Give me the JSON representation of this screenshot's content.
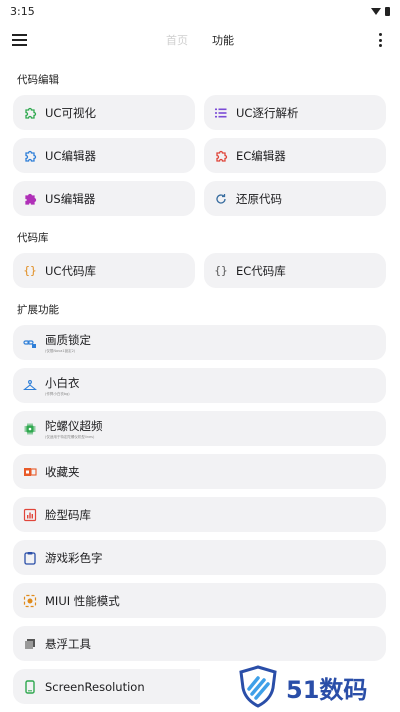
{
  "status_bar": {
    "time": "3:15"
  },
  "header": {
    "tabs": [
      "首页",
      "功能"
    ]
  },
  "sections": {
    "code_edit": {
      "title": "代码编辑",
      "items": [
        "UC可视化",
        "UC逐行解析",
        "UC编辑器",
        "EC编辑器",
        "US编辑器",
        "还原代码"
      ]
    },
    "code_lib": {
      "title": "代码库",
      "items": [
        "UC代码库",
        "EC代码库"
      ]
    },
    "extensions": {
      "title": "扩展功能",
      "items": [
        {
          "label": "画质锁定",
          "sub": "(仅限Nova1锁定2)"
        },
        {
          "label": "小白衣",
          "sub": "(作弊小白衣bg)"
        },
        {
          "label": "陀螺仪超频",
          "sub": "(仅适用于特定陀螺仪机型lines)"
        },
        {
          "label": "收藏夹"
        },
        {
          "label": "脸型码库"
        },
        {
          "label": "游戏彩色字"
        },
        {
          "label": "MIUI 性能模式"
        },
        {
          "label": "悬浮工具"
        },
        {
          "label": "ScreenResolution"
        }
      ]
    }
  },
  "watermark": {
    "text": "51数码"
  },
  "colors": {
    "card_bg": "#f2f2f4",
    "green": "#2fa84f",
    "purple": "#7b4bd6",
    "blue": "#2f7fd8",
    "red": "#e0453a",
    "magenta": "#b030b8",
    "orange": "#e08a1a",
    "brand_blue": "#2a4ea8"
  }
}
